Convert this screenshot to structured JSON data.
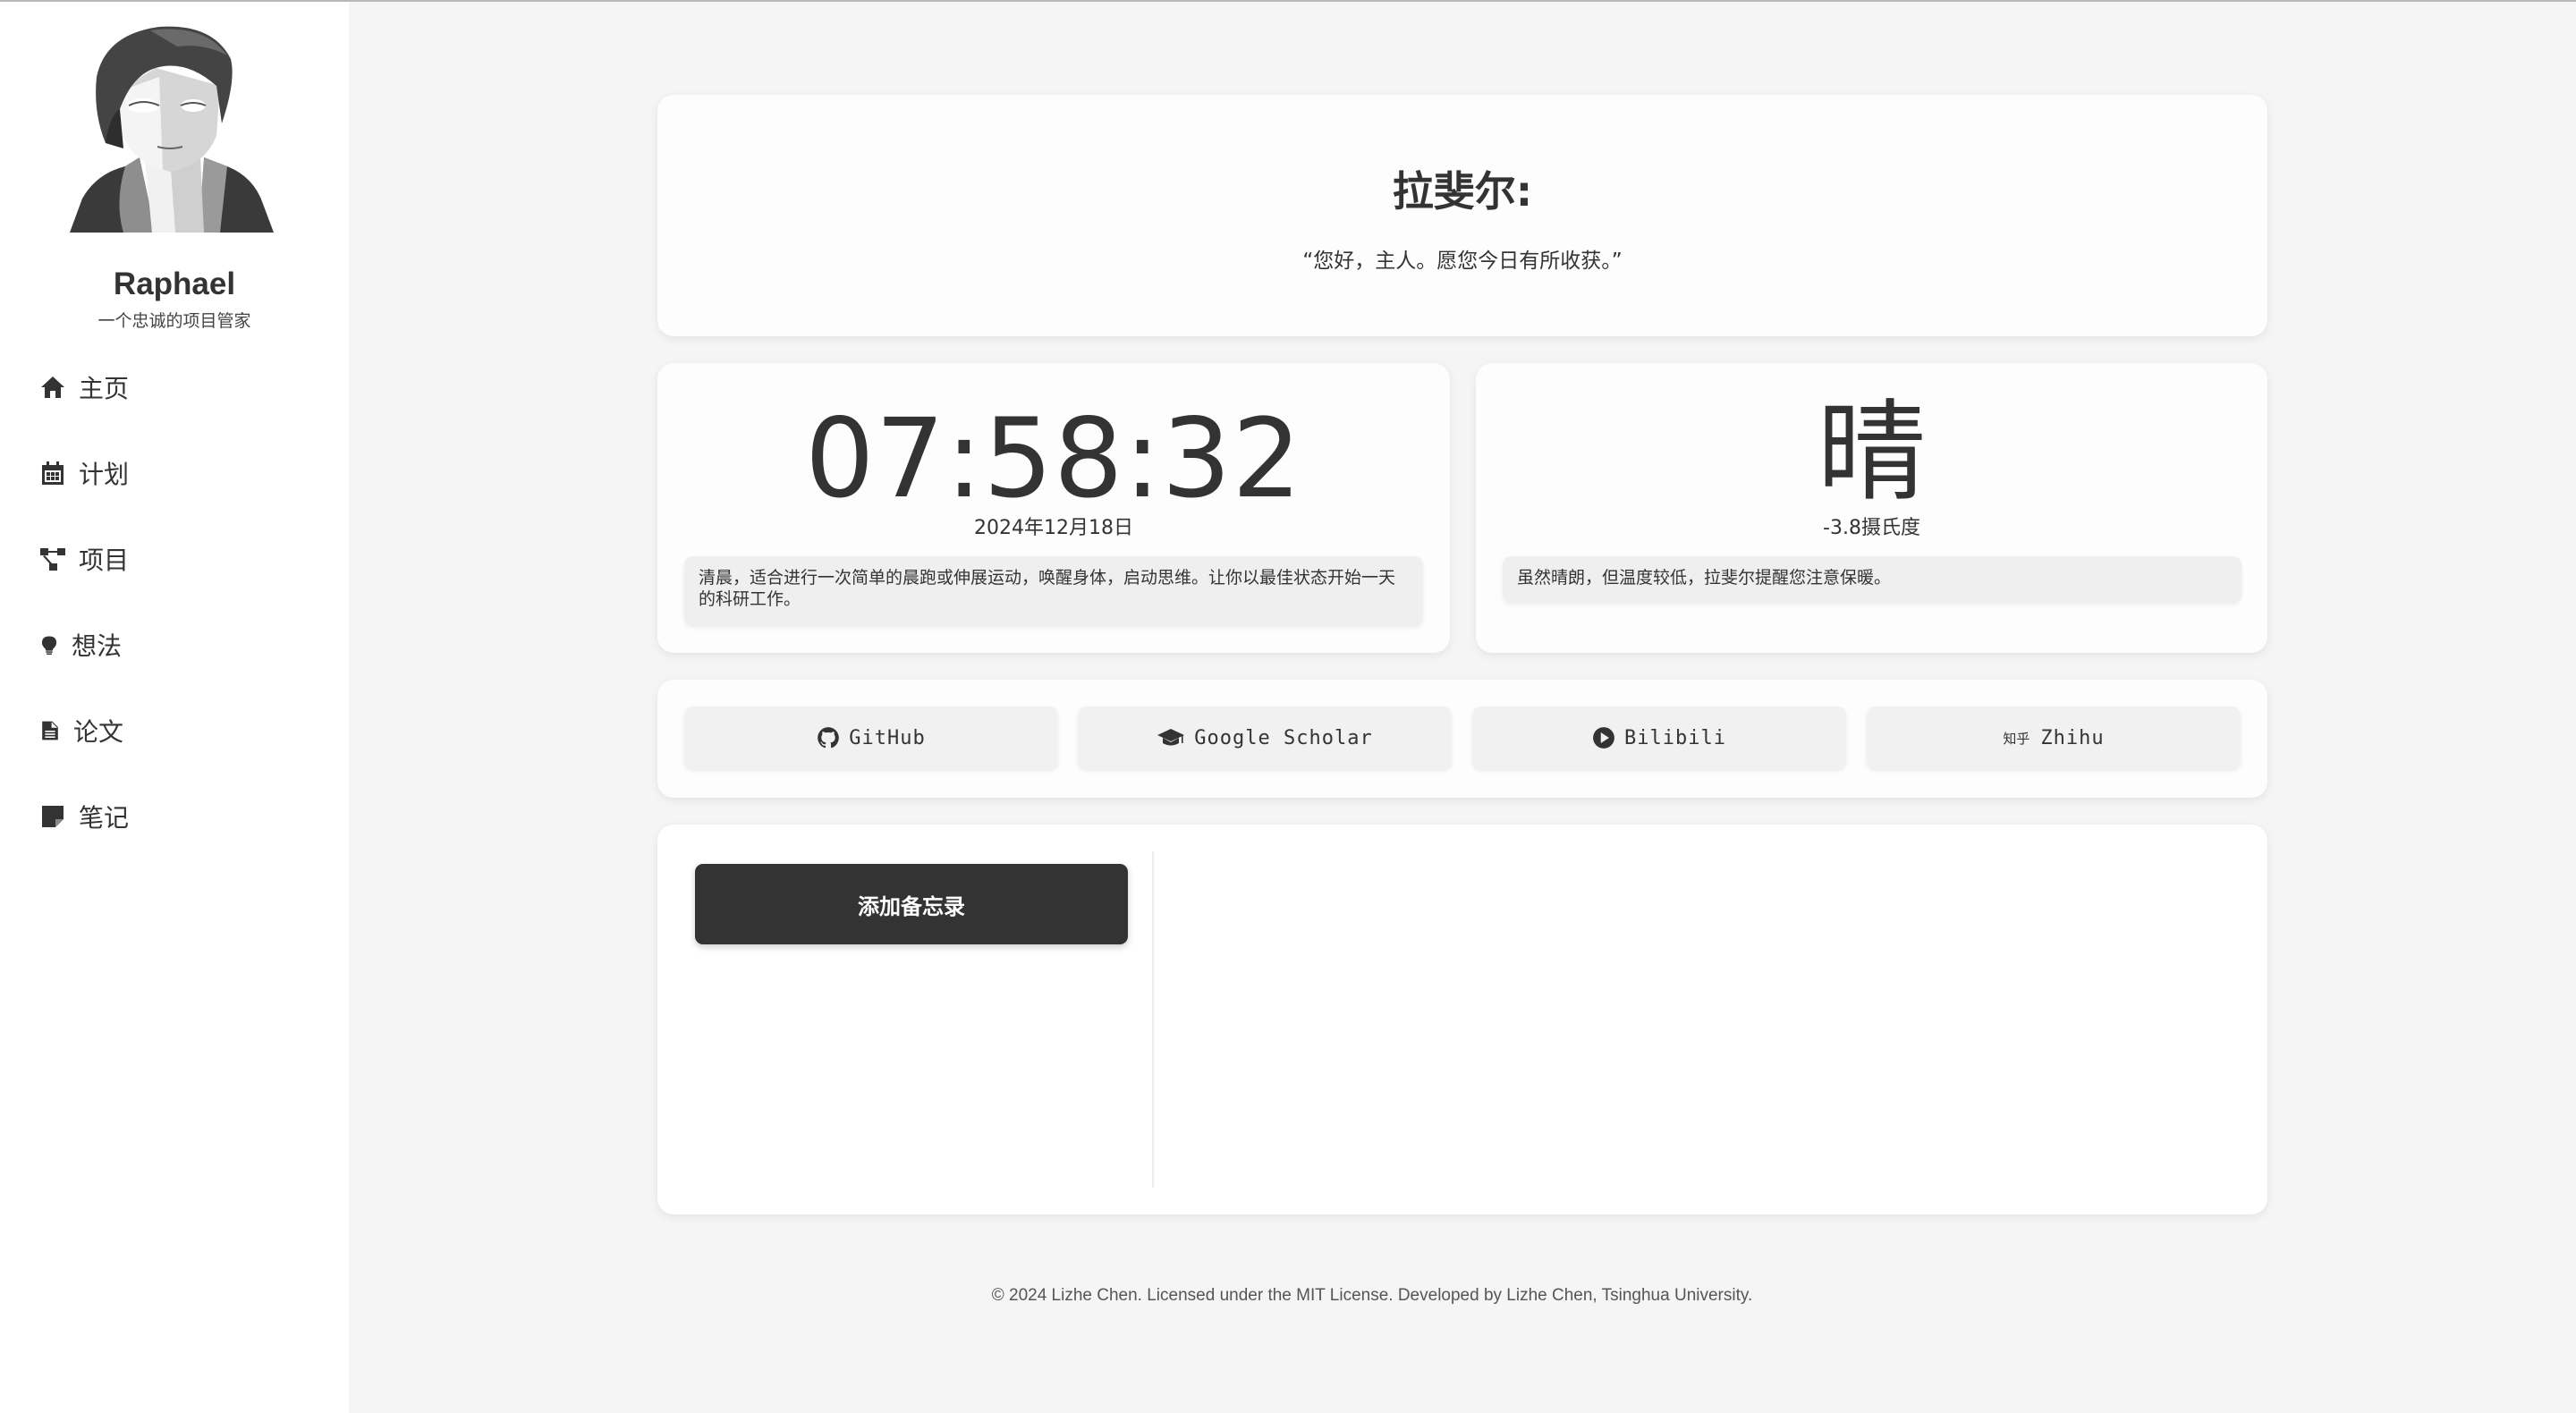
{
  "profile": {
    "name": "Raphael",
    "subtitle": "一个忠诚的项目管家"
  },
  "nav": {
    "items": [
      {
        "label": "主页",
        "icon": "home-icon"
      },
      {
        "label": "计划",
        "icon": "calendar-icon"
      },
      {
        "label": "项目",
        "icon": "project-diagram-icon"
      },
      {
        "label": "想法",
        "icon": "lightbulb-icon"
      },
      {
        "label": "论文",
        "icon": "file-icon"
      },
      {
        "label": "笔记",
        "icon": "sticky-note-icon"
      }
    ]
  },
  "greeting": {
    "title": "拉斐尔:",
    "quote": "“您好，主人。愿您今日有所收获。”"
  },
  "clock": {
    "time": "07:58:32",
    "date": "2024年12月18日",
    "tip": "清晨，适合进行一次简单的晨跑或伸展运动，唤醒身体，启动思维。让你以最佳状态开始一天的科研工作。"
  },
  "weather": {
    "condition": "晴",
    "temperature": "-3.8摄氏度",
    "tip": "虽然晴朗，但温度较低，拉斐尔提醒您注意保暖。"
  },
  "links": [
    {
      "label": "GitHub",
      "icon": "github-icon"
    },
    {
      "label": "Google Scholar",
      "icon": "graduation-cap-icon"
    },
    {
      "label": "Bilibili",
      "icon": "play-circle-icon"
    },
    {
      "label": "Zhihu",
      "icon": "zhihu-icon",
      "mark": "知乎"
    }
  ],
  "memo": {
    "add_label": "添加备忘录"
  },
  "footer": {
    "text": "© 2024 Lizhe Chen. Licensed under the MIT License. Developed by Lizhe Chen, Tsinghua University."
  },
  "colors": {
    "background": "#f5f5f5",
    "sidebar": "#ffffff",
    "card": "#fdfdfd",
    "accent_dark": "#333333",
    "tip_box": "#efefef"
  }
}
